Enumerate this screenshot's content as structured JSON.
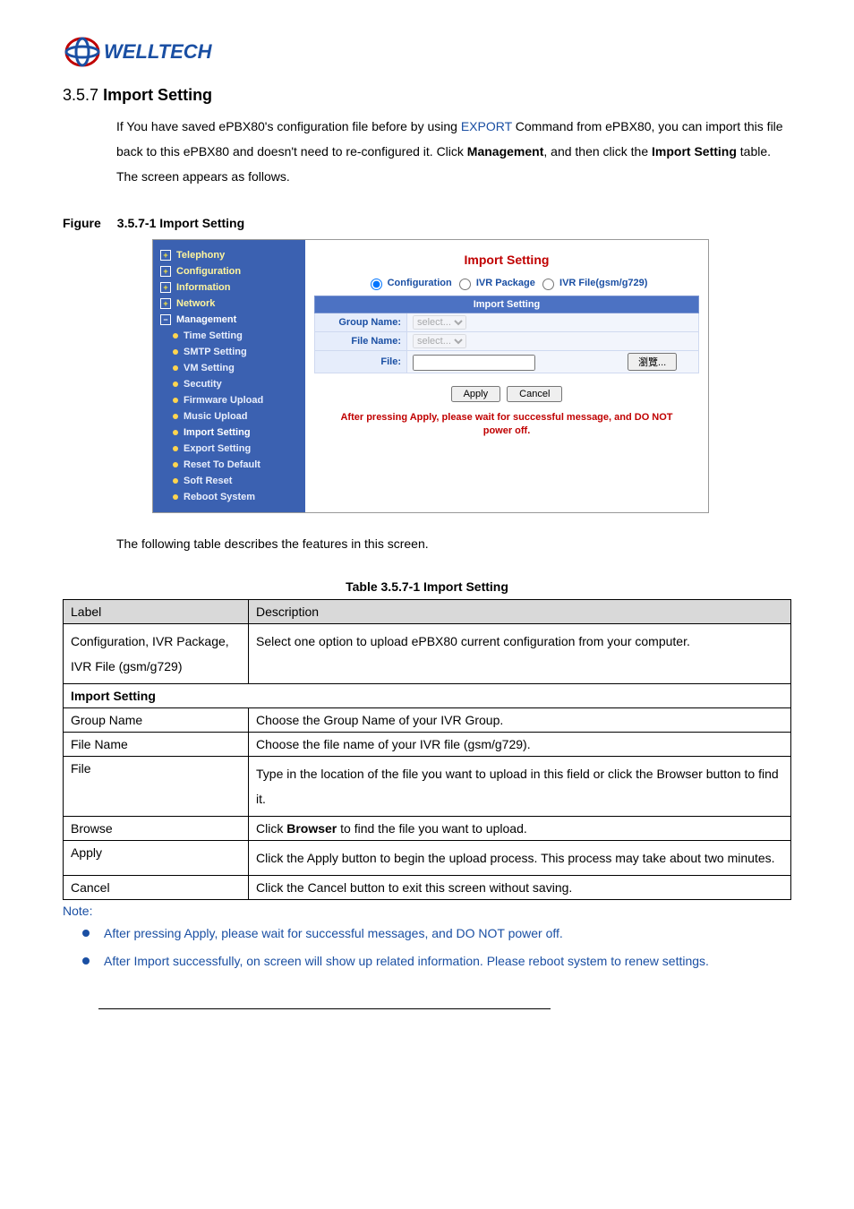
{
  "logo": {
    "brand": "WELLTECH"
  },
  "heading": {
    "num": "3.5.7",
    "title": "Import Setting"
  },
  "intro": {
    "line1_a": "If You have saved ePBX80's configuration file before by using ",
    "line1_link": "EXPORT",
    "line1_b": " Command from ePBX80, you can import this file back to this ePBX80 and doesn't need to re-configured it. Click ",
    "kw1": "Management",
    "line1_c": ", and then click the ",
    "kw2": "Import Setting",
    "line1_d": " table. The screen appears as follows."
  },
  "fig_caption": {
    "prefix": "Figure",
    "rest": "3.5.7-1 Import Setting"
  },
  "sidebar": {
    "items": [
      {
        "label": "Telephony",
        "icon": "plus"
      },
      {
        "label": "Configuration",
        "icon": "plus"
      },
      {
        "label": "Information",
        "icon": "plus"
      },
      {
        "label": "Network",
        "icon": "plus"
      },
      {
        "label": "Management",
        "icon": "minus"
      }
    ],
    "subitems": [
      "Time Setting",
      "SMTP Setting",
      "VM Setting",
      "Secutity",
      "Firmware Upload",
      "Music Upload",
      "Import Setting",
      "Export Setting",
      "Reset To Default",
      "Soft Reset",
      "Reboot System"
    ]
  },
  "panel": {
    "title": "Import Setting",
    "radios": {
      "r1": "Configuration",
      "r2": "IVR Package",
      "r3": "IVR File(gsm/g729)"
    },
    "tbl_header": "Import Setting",
    "rows": {
      "group_name_label": "Group Name:",
      "group_name_value": "select...",
      "file_name_label": "File Name:",
      "file_name_value": "select...",
      "file_label": "File:",
      "browse_btn": "瀏覽..."
    },
    "apply": "Apply",
    "cancel": "Cancel",
    "warn1": "After pressing Apply, please wait for successful message, and DO NOT",
    "warn2": "power off."
  },
  "after_fig": "The following table describes the features in this screen.",
  "tbl_caption": "Table 3.5.7-1 Import Setting",
  "desc_tbl": {
    "h1": "Label",
    "h2": "Description",
    "rows": [
      {
        "label": "Configuration, IVR Package, IVR File (gsm/g729)",
        "desc": "Select one option to upload ePBX80 current configuration from your computer."
      }
    ],
    "section": "Import Setting",
    "rows2": [
      {
        "label": "Group Name",
        "desc": "Choose the Group Name of your IVR Group."
      },
      {
        "label": "File Name",
        "desc": "Choose the file name of your IVR file (gsm/g729)."
      },
      {
        "label": "File",
        "desc": "Type in the location of the file you want to upload in this field or click the Browser button to find it."
      },
      {
        "label": "Browse",
        "desc_pref": "Click ",
        "desc_bold": "Browser",
        "desc_suf": " to find the file you want to upload."
      },
      {
        "label": "Apply",
        "desc": "Click the Apply button to begin the upload process. This process may take about two minutes."
      },
      {
        "label": "Cancel",
        "desc": "Click the Cancel button to exit this screen without saving."
      }
    ]
  },
  "note": {
    "heading": "Note:",
    "items": [
      "After pressing Apply, please wait for successful messages, and DO NOT power off.",
      "After Import successfully, on screen will show up related information. Please reboot system to renew settings."
    ]
  }
}
